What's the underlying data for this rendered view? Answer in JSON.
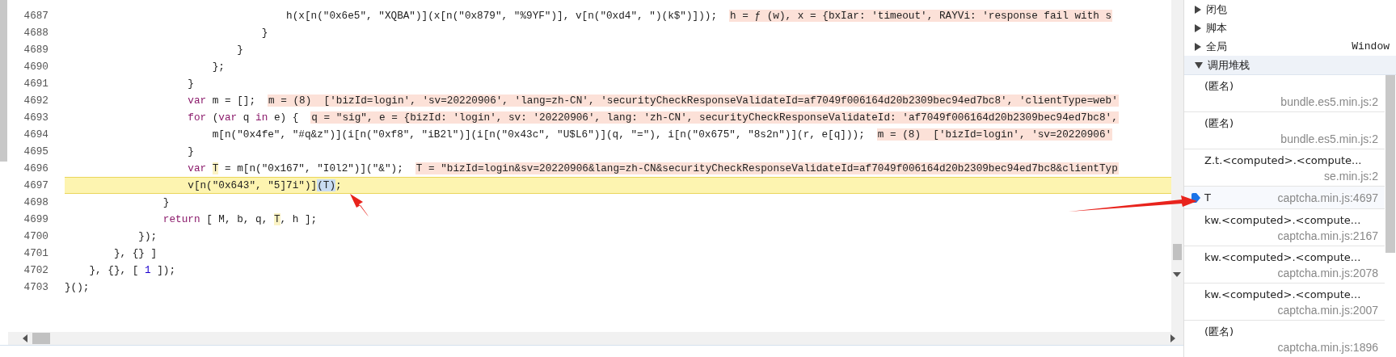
{
  "editor": {
    "lines": [
      {
        "number": "4687",
        "current": false,
        "segments": [
          {
            "kind": "code",
            "text": "                                    h(x[n(\"0x6e5\", \"XQBA\")](x[n(\"0x879\", \"%9YF\")], v[n(\"0xd4\", \")(k$\")]));"
          },
          {
            "kind": "hint",
            "text": "h = ƒ (w), x = {bxIar: 'timeout', RAYVi: 'response fail with s"
          }
        ]
      },
      {
        "number": "4688",
        "current": false,
        "segments": [
          {
            "kind": "code",
            "text": "                                }"
          }
        ]
      },
      {
        "number": "4689",
        "current": false,
        "segments": [
          {
            "kind": "code",
            "text": "                            }"
          }
        ]
      },
      {
        "number": "4690",
        "current": false,
        "segments": [
          {
            "kind": "code",
            "text": "                        };"
          }
        ]
      },
      {
        "number": "4691",
        "current": false,
        "segments": [
          {
            "kind": "code",
            "text": "                    }"
          }
        ]
      },
      {
        "number": "4692",
        "current": false,
        "segments": [
          {
            "kind": "keyword",
            "text": "                    var"
          },
          {
            "kind": "code",
            "text": " m = [];"
          },
          {
            "kind": "hint",
            "text": "m = (8)  ['bizId=login', 'sv=20220906', 'lang=zh-CN', 'securityCheckResponseValidateId=af7049f006164d20b2309bec94ed7bc8', 'clientType=web'"
          }
        ]
      },
      {
        "number": "4693",
        "current": false,
        "segments": [
          {
            "kind": "keyword",
            "text": "                    for"
          },
          {
            "kind": "code",
            "text": " ("
          },
          {
            "kind": "keyword",
            "text": "var"
          },
          {
            "kind": "code",
            "text": " q "
          },
          {
            "kind": "keyword",
            "text": "in"
          },
          {
            "kind": "code",
            "text": " e) {"
          },
          {
            "kind": "hint",
            "text": "q = \"sig\", e = {bizId: 'login', sv: '20220906', lang: 'zh-CN', securityCheckResponseValidateId: 'af7049f006164d20b2309bec94ed7bc8',"
          }
        ]
      },
      {
        "number": "4694",
        "current": false,
        "segments": [
          {
            "kind": "code",
            "text": "                        m[n(\"0x4fe\", \"#q&z\")](i[n(\"0xf8\", \"iB2l\")](i[n(\"0x43c\", \"U$L6\")](q, \"=\"), i[n(\"0x675\", \"8s2n\")](r, e[q]));"
          },
          {
            "kind": "hint",
            "text": "m = (8)  ['bizId=login', 'sv=20220906'"
          }
        ]
      },
      {
        "number": "4695",
        "current": false,
        "segments": [
          {
            "kind": "code",
            "text": "                    }"
          }
        ]
      },
      {
        "number": "4696",
        "current": false,
        "segments": [
          {
            "kind": "keyword",
            "text": "                    var "
          },
          {
            "kind": "variable",
            "text": "T"
          },
          {
            "kind": "code",
            "text": " = m[n(\"0x167\", \"I0l2\")](\"&\");"
          },
          {
            "kind": "hint",
            "text": "T = \"bizId=login&sv=20220906&lang=zh-CN&securityCheckResponseValidateId=af7049f006164d20b2309bec94ed7bc8&clientTyp"
          }
        ]
      },
      {
        "number": "4697",
        "current": true,
        "segments": [
          {
            "kind": "code",
            "text": "                    v[n(\"0x643\", \"5]7i\")]"
          },
          {
            "kind": "selection",
            "text": "(T)"
          },
          {
            "kind": "code",
            "text": ";"
          }
        ]
      },
      {
        "number": "4698",
        "current": false,
        "segments": [
          {
            "kind": "code",
            "text": "                }"
          }
        ]
      },
      {
        "number": "4699",
        "current": false,
        "segments": [
          {
            "kind": "keyword",
            "text": "                return"
          },
          {
            "kind": "code",
            "text": " [ M, b, q, "
          },
          {
            "kind": "variable",
            "text": "T"
          },
          {
            "kind": "code",
            "text": ", h ];"
          }
        ]
      },
      {
        "number": "4700",
        "current": false,
        "segments": [
          {
            "kind": "code",
            "text": "            });"
          }
        ]
      },
      {
        "number": "4701",
        "current": false,
        "segments": [
          {
            "kind": "code",
            "text": "        }, {} ]"
          }
        ]
      },
      {
        "number": "4702",
        "current": false,
        "segments": [
          {
            "kind": "code",
            "text": "    }, {}, [ "
          },
          {
            "kind": "number",
            "text": "1"
          },
          {
            "kind": "code",
            "text": " ]);"
          }
        ]
      },
      {
        "number": "4703",
        "current": false,
        "segments": [
          {
            "kind": "code",
            "text": "}();"
          }
        ]
      }
    ]
  },
  "scope_sections": [
    {
      "label": "闭包",
      "expanded": false
    },
    {
      "label": "脚本",
      "expanded": false
    },
    {
      "label": "全局",
      "value": "Window",
      "expanded": false
    },
    {
      "label": "调用堆栈",
      "expanded": true
    }
  ],
  "call_stack": [
    {
      "name": "(匿名)",
      "location": "bundle.es5.min.js:2",
      "selected": false
    },
    {
      "name": "(匿名)",
      "location": "bundle.es5.min.js:2",
      "selected": false
    },
    {
      "name": "Z.t.<computed>.<compute...",
      "location": "se.min.js:2",
      "selected": false
    },
    {
      "name": "T",
      "location": "captcha.min.js:4697",
      "selected": true
    },
    {
      "name": "kw.<computed>.<compute...",
      "location": "captcha.min.js:2167",
      "selected": false
    },
    {
      "name": "kw.<computed>.<compute...",
      "location": "captcha.min.js:2078",
      "selected": false
    },
    {
      "name": "kw.<computed>.<compute...",
      "location": "captcha.min.js:2007",
      "selected": false
    },
    {
      "name": "(匿名)",
      "location": "captcha.min.js:1896",
      "selected": false
    }
  ]
}
